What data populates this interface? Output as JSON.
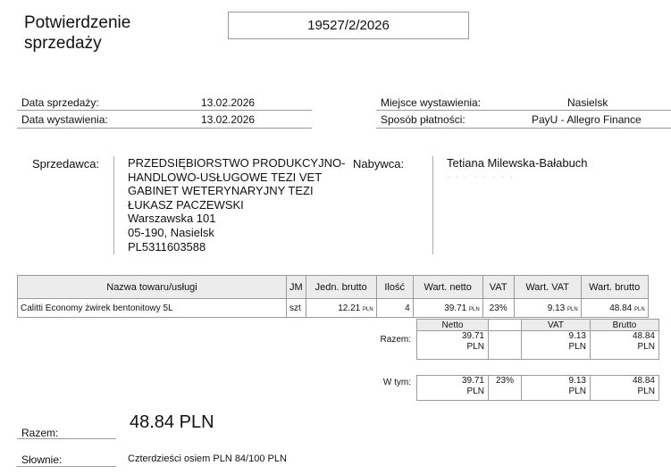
{
  "header": {
    "title_line1": "Potwierdzenie",
    "title_line2": "sprzedaży",
    "document_number": "19527/2/2026"
  },
  "meta": {
    "sale_date_label": "Data sprzedaży:",
    "sale_date_value": "13.02.2026",
    "issue_date_label": "Data wystawienia:",
    "issue_date_value": "13.02.2026",
    "place_label": "Miejsce wystawienia:",
    "place_value": "Nasielsk",
    "payment_label": "Sposób płatności:",
    "payment_value": "PayU - Allegro Finance"
  },
  "seller": {
    "label": "Sprzedawca:",
    "lines": [
      "PRZEDSIĘBIORSTWO PRODUKCYJNO-",
      "HANDLOWO-USŁUGOWE TEZI VET",
      "GABINET WETERYNARYJNY TEZI",
      "ŁUKASZ PACZEWSKI",
      "Warszawska 101",
      "05-190, Nasielsk",
      "PL5311603588"
    ]
  },
  "buyer": {
    "label": "Nabywca:",
    "name": "Tetiana Milewska-Bałabuch"
  },
  "items_table": {
    "headers": [
      "Nazwa towaru/usługi",
      "JM",
      "Jedn. brutto",
      "Ilość",
      "Wart. netto",
      "VAT",
      "Wart. VAT",
      "Wart. brutto"
    ],
    "rows": [
      {
        "name": "Calitti Economy żwirek bentonitowy 5L",
        "unit": "szt",
        "unit_gross": "12.21",
        "qty": "4",
        "net": "39.71",
        "vat_rate": "23%",
        "vat": "9.13",
        "gross": "48.84"
      }
    ],
    "currency": "PLN"
  },
  "summary": {
    "headers": [
      "Netto",
      "VAT",
      "Brutto"
    ],
    "razem_label": "Razem:",
    "razem": {
      "net": "39.71",
      "vat": "9.13",
      "gross": "48.84",
      "currency": "PLN"
    },
    "wtym_label": "W tym:",
    "wtym": {
      "net": "39.71",
      "rate": "23%",
      "vat": "9.13",
      "gross": "48.84",
      "currency": "PLN"
    }
  },
  "total": {
    "label": "Razem:",
    "value": "48.84 PLN",
    "words_label": "Słownie:",
    "words_value": "Czterdzieści osiem PLN 84/100 PLN"
  }
}
